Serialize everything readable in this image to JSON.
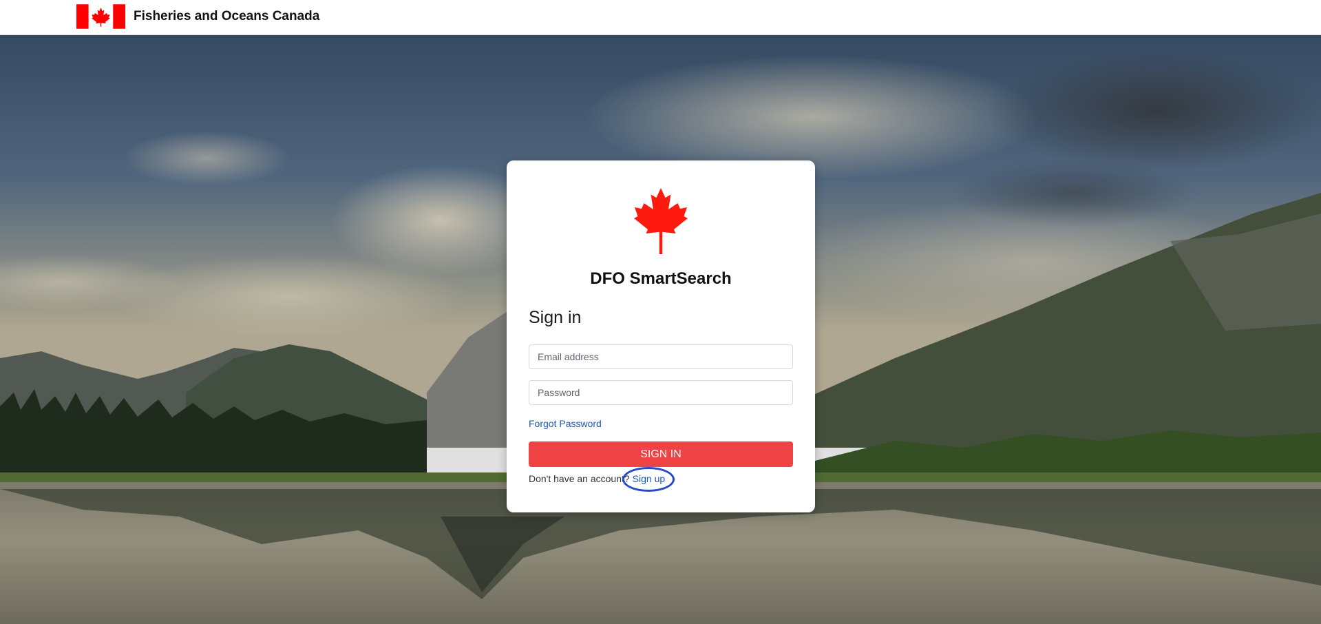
{
  "header": {
    "title": "Fisheries and Oceans Canada",
    "flag_icon": "canada-flag-icon"
  },
  "background": {
    "icon": "lake-mountain-landscape-photo"
  },
  "login": {
    "logo_icon": "maple-leaf-icon",
    "app_title": "DFO SmartSearch",
    "heading": "Sign in",
    "email_placeholder": "Email address",
    "email_value": "",
    "password_placeholder": "Password",
    "password_value": "",
    "forgot_password": "Forgot Password",
    "submit_label": "SIGN IN",
    "no_account_text": "Don't have an account?",
    "signup_link": "Sign up"
  },
  "colors": {
    "accent_red": "#ee4245",
    "link_blue": "#1a55c8",
    "annotation_circle": "#2149c9",
    "flag_red": "#ff0000"
  }
}
